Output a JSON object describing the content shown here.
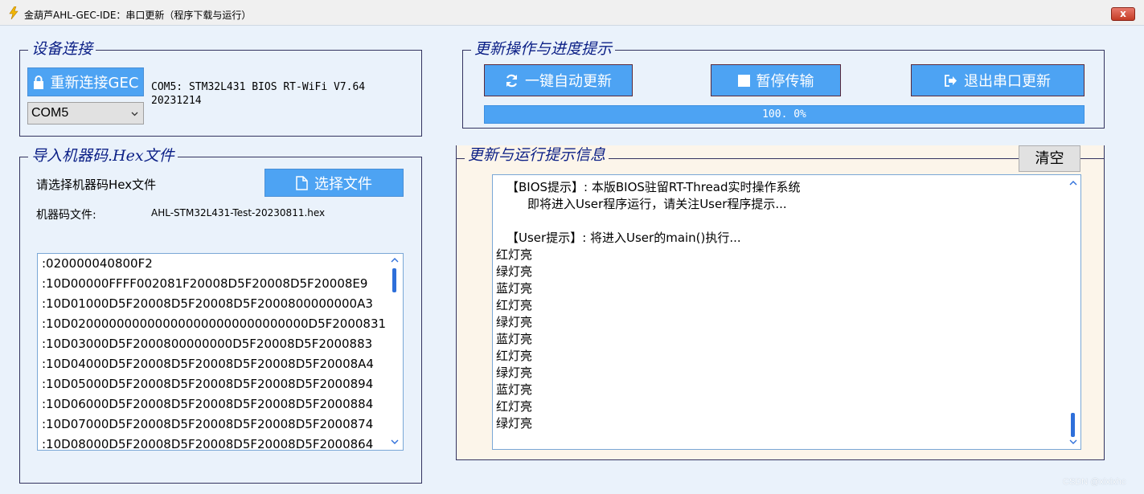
{
  "window": {
    "title": "金葫芦AHL-GEC-IDE：串口更新（程序下载与运行）",
    "close_label": "x"
  },
  "device_panel": {
    "legend": "设备连接",
    "reconnect_label": "重新连接GEC",
    "port_selected": "COM5",
    "device_info_line1": "COM5:  STM32L431 BIOS RT-WiFi V7.64",
    "device_info_line2": "20231214"
  },
  "hex_panel": {
    "legend": "导入机器码.Hex文件",
    "prompt": "请选择机器码Hex文件",
    "choose_label": "选择文件",
    "file_label": "机器码文件:",
    "file_name": "AHL-STM32L431-Test-20230811.hex",
    "lines": [
      ":020000040800F2",
      ":10D00000FFFF002081F20008D5F20008D5F20008E9",
      ":10D01000D5F20008D5F20008D5F2000800000000A3",
      ":10D0200000000000000000000000000000D5F2000831",
      ":10D03000D5F2000800000000D5F20008D5F2000883",
      ":10D04000D5F20008D5F20008D5F20008D5F20008A4",
      ":10D05000D5F20008D5F20008D5F20008D5F2000894",
      ":10D06000D5F20008D5F20008D5F20008D5F2000884",
      ":10D07000D5F20008D5F20008D5F20008D5F2000874",
      ":10D08000D5F20008D5F20008D5F20008D5F2000864"
    ]
  },
  "update_panel": {
    "legend": "更新操作与进度提示",
    "auto_update_label": "一键自动更新",
    "pause_label": "暂停传输",
    "exit_label": "退出串口更新",
    "progress_text": "100. 0%",
    "progress_value": 1.0
  },
  "log_panel": {
    "legend": "更新与运行提示信息",
    "clear_label": "清空",
    "lines": [
      "【BIOS提示】: 本版BIOS驻留RT-Thread实时操作系统",
      "即将进入User程序运行，请关注User程序提示...",
      "",
      "【User提示】: 将进入User的main()执行...",
      "红灯亮",
      "绿灯亮",
      "蓝灯亮",
      "红灯亮",
      "绿灯亮",
      "蓝灯亮",
      "红灯亮",
      "绿灯亮",
      "蓝灯亮",
      "红灯亮",
      "绿灯亮"
    ]
  },
  "watermark": "CSDN @xlxlxhc",
  "colors": {
    "accent_blue": "#4da3f3",
    "legend_text": "#0b1f86",
    "window_bg": "#eaf2fb",
    "log_bg": "#fcf5ea"
  }
}
